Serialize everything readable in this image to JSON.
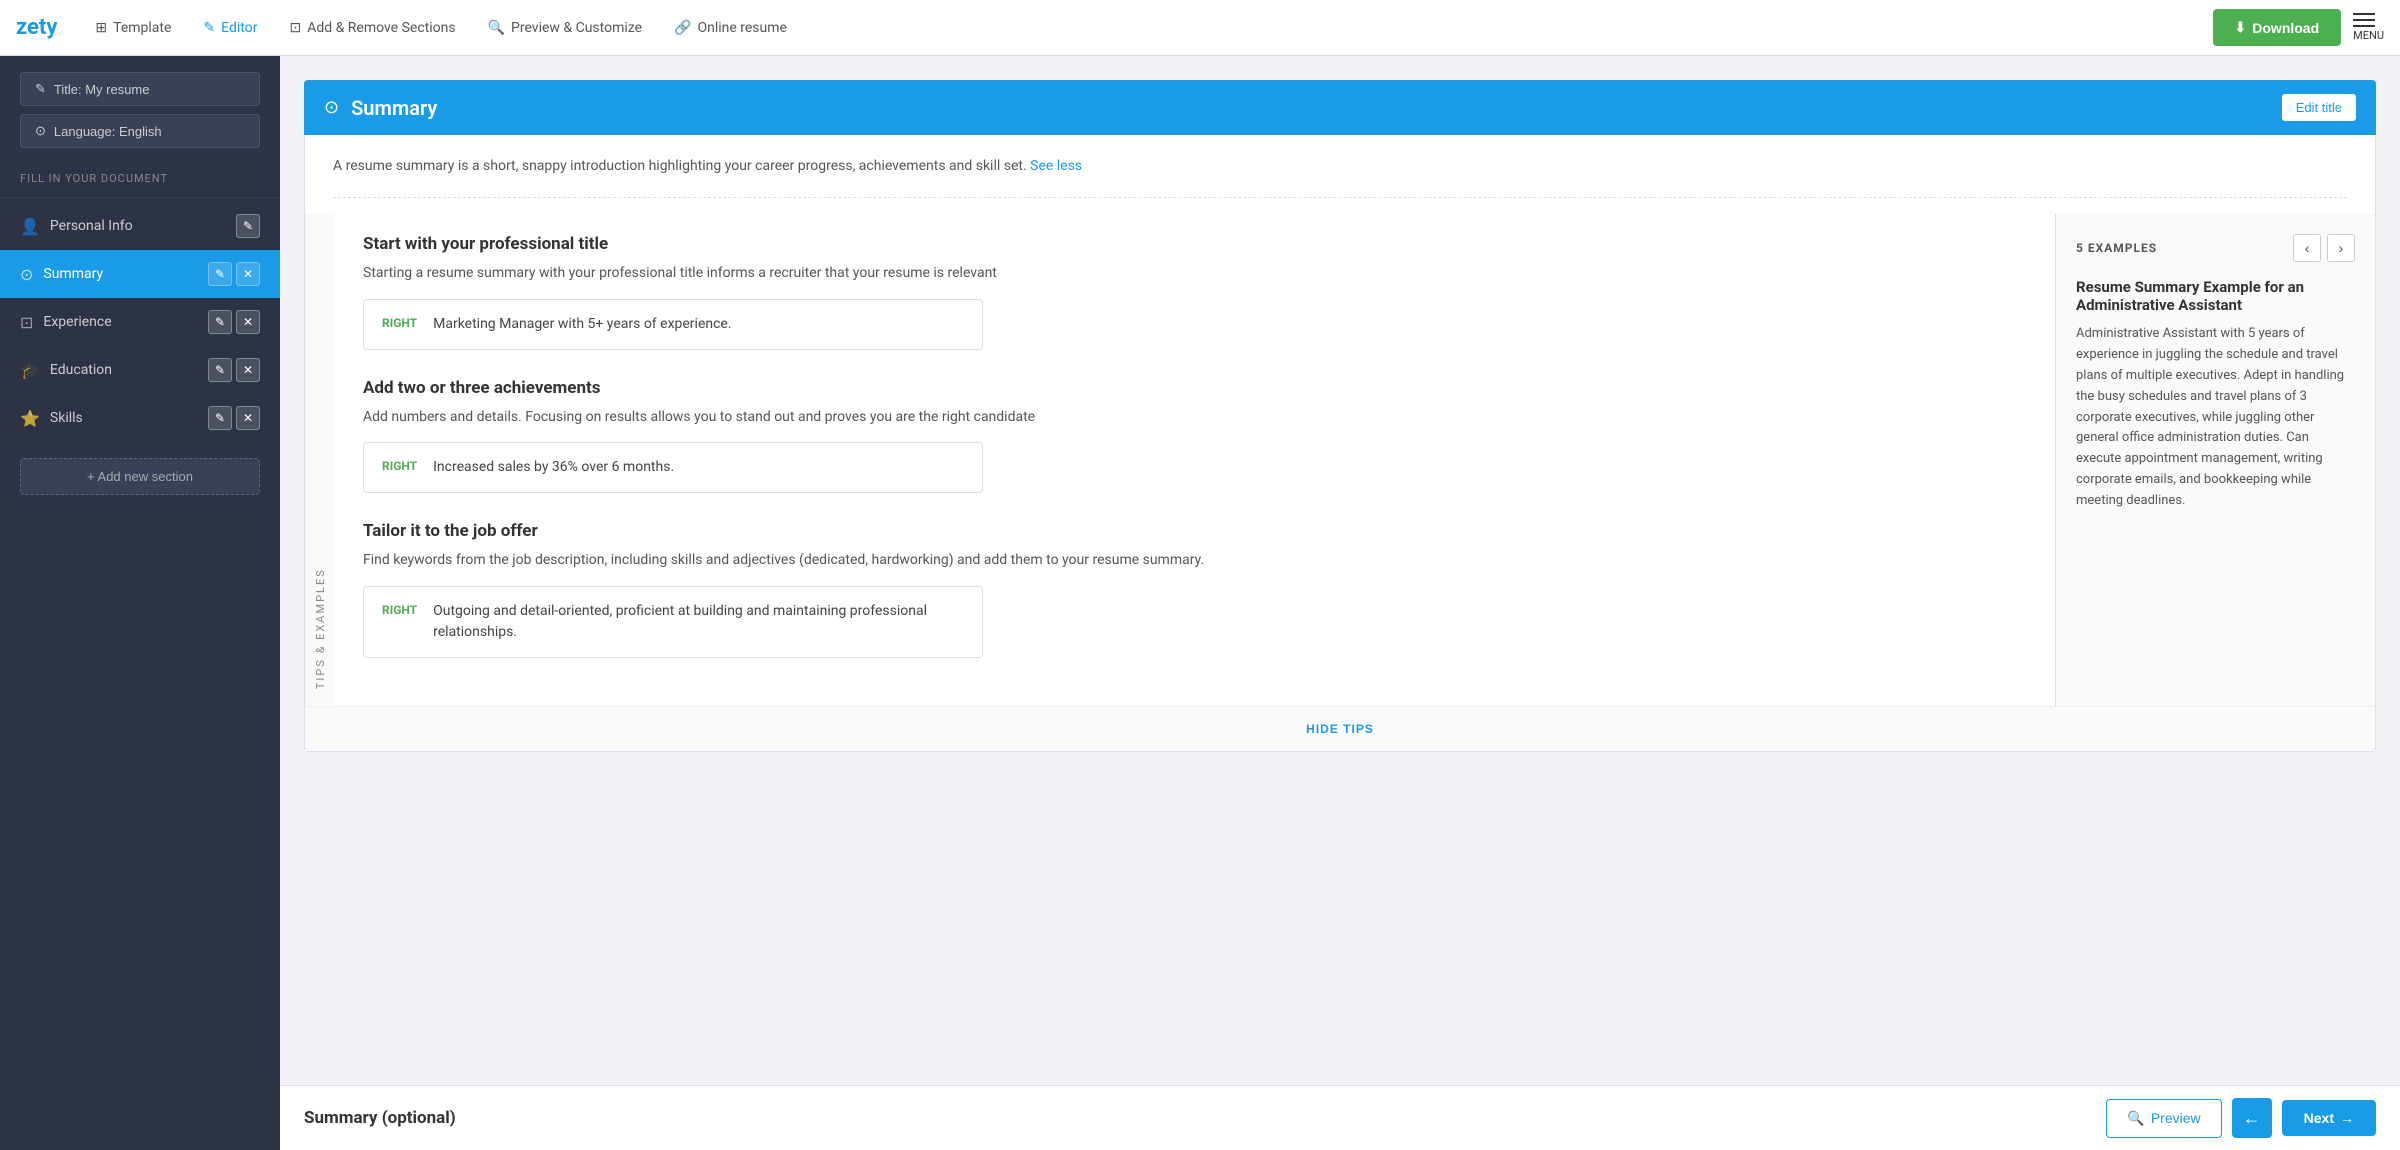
{
  "brand": {
    "name": "zety"
  },
  "topnav": {
    "items": [
      {
        "id": "template",
        "label": "Template",
        "icon": "⊞",
        "active": false
      },
      {
        "id": "editor",
        "label": "Editor",
        "icon": "✎",
        "active": true
      },
      {
        "id": "add-remove",
        "label": "Add & Remove Sections",
        "icon": "⊡",
        "active": false
      },
      {
        "id": "preview",
        "label": "Preview & Customize",
        "icon": "🔍",
        "active": false
      },
      {
        "id": "online",
        "label": "Online resume",
        "icon": "🔗",
        "active": false
      }
    ],
    "download_label": "Download",
    "menu_label": "MENU"
  },
  "sidebar": {
    "top_buttons": [
      {
        "id": "title-btn",
        "label": "Title: My resume",
        "icon": "✎"
      },
      {
        "id": "language-btn",
        "label": "Language: English",
        "icon": "⊙"
      }
    ],
    "fill_label": "FILL IN YOUR DOCUMENT",
    "items": [
      {
        "id": "personal-info",
        "label": "Personal Info",
        "icon": "👤",
        "active": false,
        "has_actions": true
      },
      {
        "id": "summary",
        "label": "Summary",
        "icon": "⊙",
        "active": true,
        "has_actions": true
      },
      {
        "id": "experience",
        "label": "Experience",
        "icon": "⊡",
        "active": false,
        "has_actions": true
      },
      {
        "id": "education",
        "label": "Education",
        "icon": "🎓",
        "active": false,
        "has_actions": true
      },
      {
        "id": "skills",
        "label": "Skills",
        "icon": "⭐",
        "active": false,
        "has_actions": true
      }
    ],
    "add_section_label": "+ Add new section"
  },
  "main": {
    "section_header": {
      "icon": "⊙",
      "title": "Summary",
      "edit_title_label": "Edit title"
    },
    "intro_text": "A resume summary is a short, snappy introduction highlighting your career progress, achievements and skill set.",
    "see_less_label": "See less",
    "tips_label": "TIPS & EXAMPLES",
    "tips": [
      {
        "id": "tip-1",
        "title": "Start with your professional title",
        "desc": "Starting a resume summary with your professional title informs a recruiter that your resume is relevant",
        "example": {
          "badge": "RIGHT",
          "text": "Marketing Manager with 5+ years of experience."
        }
      },
      {
        "id": "tip-2",
        "title": "Add two or three achievements",
        "desc": "Add numbers and details. Focusing on results allows you to stand out and proves you are the right candidate",
        "example": {
          "badge": "RIGHT",
          "text": "Increased sales by 36% over 6 months."
        }
      },
      {
        "id": "tip-3",
        "title": "Tailor it to the job offer",
        "desc": "Find keywords from the job description, including skills and adjectives (dedicated, hardworking) and add them to your resume summary.",
        "example": {
          "badge": "RIGHT",
          "text": "Outgoing and detail-oriented, proficient at building and maintaining professional relationships."
        }
      }
    ],
    "examples_panel": {
      "count_label": "5 EXAMPLES",
      "example_title": "Resume Summary Example for an Administrative Assistant",
      "example_text": "Administrative Assistant with 5 years of experience in juggling the schedule and travel plans of multiple executives. Adept in handling the busy schedules and travel plans of 3 corporate executives, while juggling other general office administration duties. Can execute appointment management, writing corporate emails, and bookkeeping while meeting deadlines."
    },
    "hide_tips_label": "HIDE TIPS",
    "bottom": {
      "section_label": "Summary (optional)",
      "preview_label": "Preview",
      "next_label": "Next"
    }
  }
}
